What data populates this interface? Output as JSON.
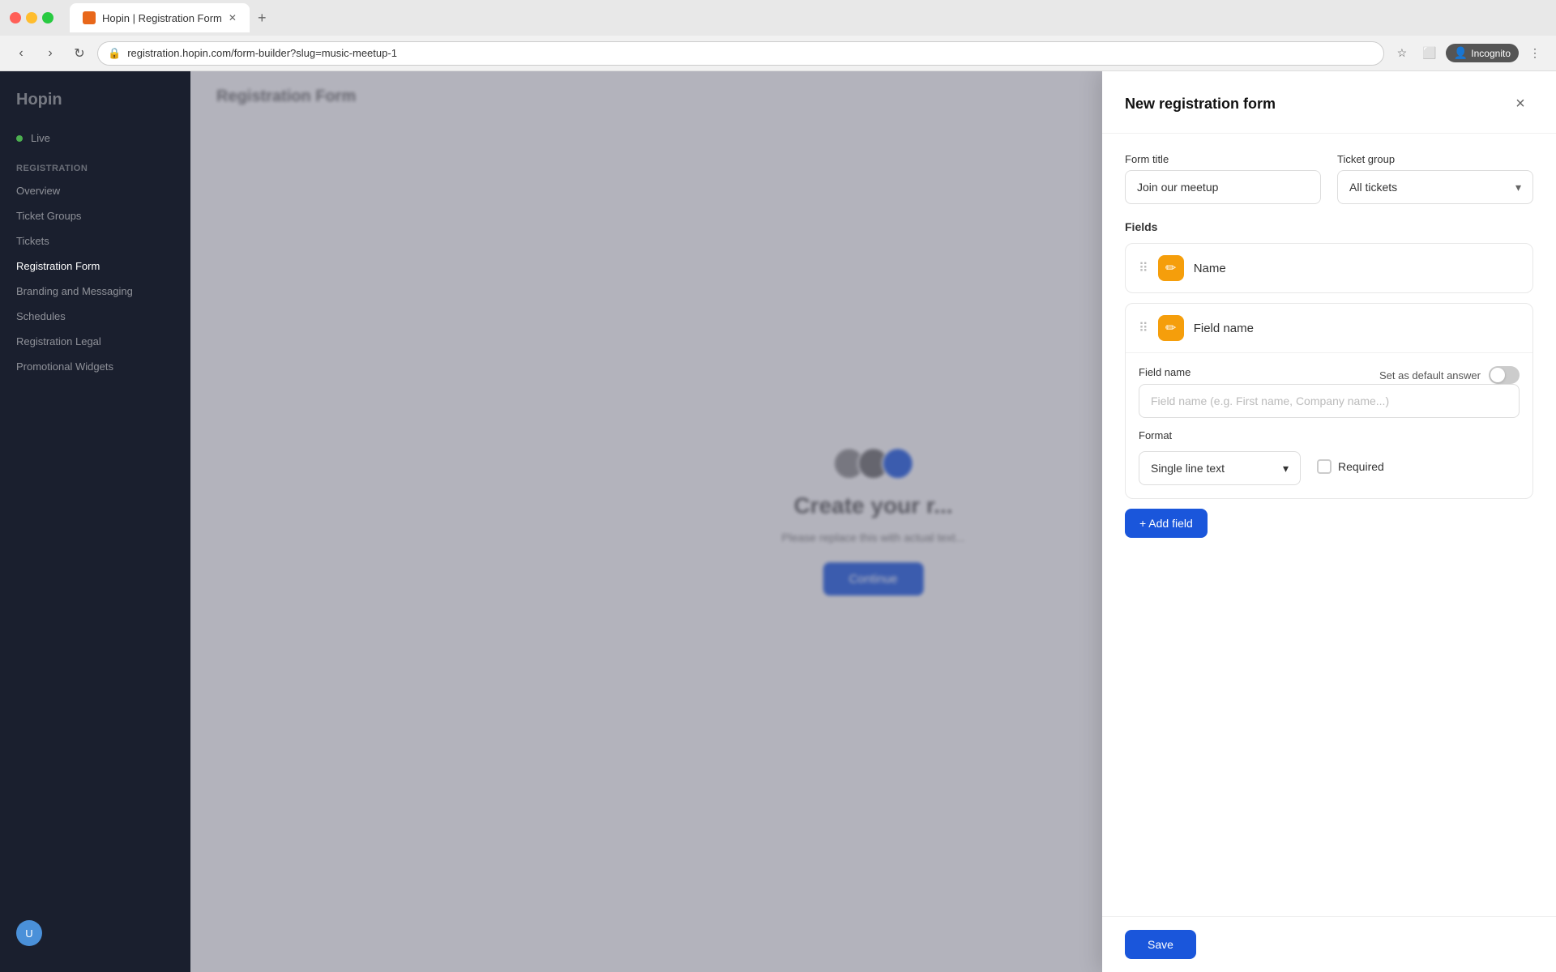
{
  "browser": {
    "tab_title": "Hopin | Registration Form",
    "tab_icon": "hopin-icon",
    "url": "registration.hopin.com/form-builder?slug=music-meetup-1",
    "incognito_label": "Incognito"
  },
  "sidebar": {
    "logo": "Hopin",
    "status_dot_label": "Live",
    "section_registration": "Registration",
    "items": [
      {
        "label": "Overview"
      },
      {
        "label": "Ticket Groups"
      },
      {
        "label": "Tickets"
      },
      {
        "label": "Registration Form",
        "active": true
      },
      {
        "label": "Branding and Messaging"
      },
      {
        "label": "Schedules"
      },
      {
        "label": "Registration Legal"
      },
      {
        "label": "Promotional Widgets"
      }
    ]
  },
  "page": {
    "title": "Registration Form"
  },
  "modal": {
    "title": "New registration form",
    "close_label": "×",
    "form_title_label": "Form title",
    "form_title_value": "Join our meetup",
    "ticket_group_label": "Ticket group",
    "ticket_group_value": "All tickets",
    "fields_label": "Fields",
    "field1": {
      "name": "Name",
      "icon": "✏"
    },
    "field2": {
      "name": "Field name",
      "icon": "✏",
      "field_name_label": "Field name",
      "field_name_placeholder": "Field name (e.g. First name, Company name...)",
      "default_answer_label": "Set as default answer",
      "format_label": "Format",
      "format_value": "Single line text",
      "required_label": "Required"
    },
    "add_field_label": "+ Add field",
    "save_label": "Save"
  },
  "bg": {
    "page_title": "Registration Form",
    "center_title": "Create your r...",
    "center_text": "Please replace this with actual text...",
    "btn_label": "Continue"
  }
}
